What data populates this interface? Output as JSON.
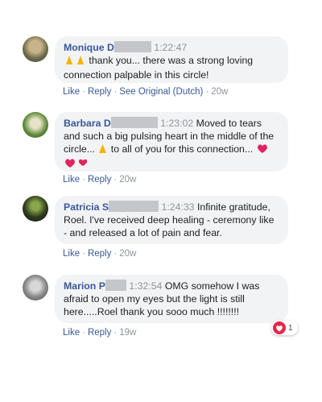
{
  "comments": [
    {
      "name": "Monique D",
      "time": "1:22:47",
      "text": "thank you... there was a strong loving connection palpable in this circle!",
      "actions": {
        "like": "Like",
        "reply": "Reply",
        "translate": "See Original (Dutch)",
        "age": "20w"
      }
    },
    {
      "name": "Barbara D",
      "time": "1:23:02",
      "text_a": "Moved to tears and such a big pulsing heart in the middle of the circle...",
      "text_b": "to all of you for this connection...",
      "actions": {
        "like": "Like",
        "reply": "Reply",
        "age": "20w"
      }
    },
    {
      "name": "Patricia S",
      "time": "1:24:33",
      "text": "Infinite gratitude, Roel. I've received deep healing - ceremony like - and released a lot of pain and fear.",
      "actions": {
        "like": "Like",
        "reply": "Reply",
        "age": "20w"
      }
    },
    {
      "name": "Marion P",
      "time": "1:32:54",
      "text": "OMG somehow I was afraid to open my eyes but the light is still here.....Roel thank you sooo much !!!!!!!!",
      "actions": {
        "like": "Like",
        "reply": "Reply",
        "age": "19w"
      },
      "reaction_count": "1"
    }
  ],
  "separator": "·",
  "colors": {
    "link": "#385898",
    "bubble": "#f2f3f5",
    "meta": "#90949c",
    "love": "#e8264b"
  },
  "icons": [
    "praying-hands-emoji",
    "heart-emoji",
    "love-reaction-icon"
  ]
}
